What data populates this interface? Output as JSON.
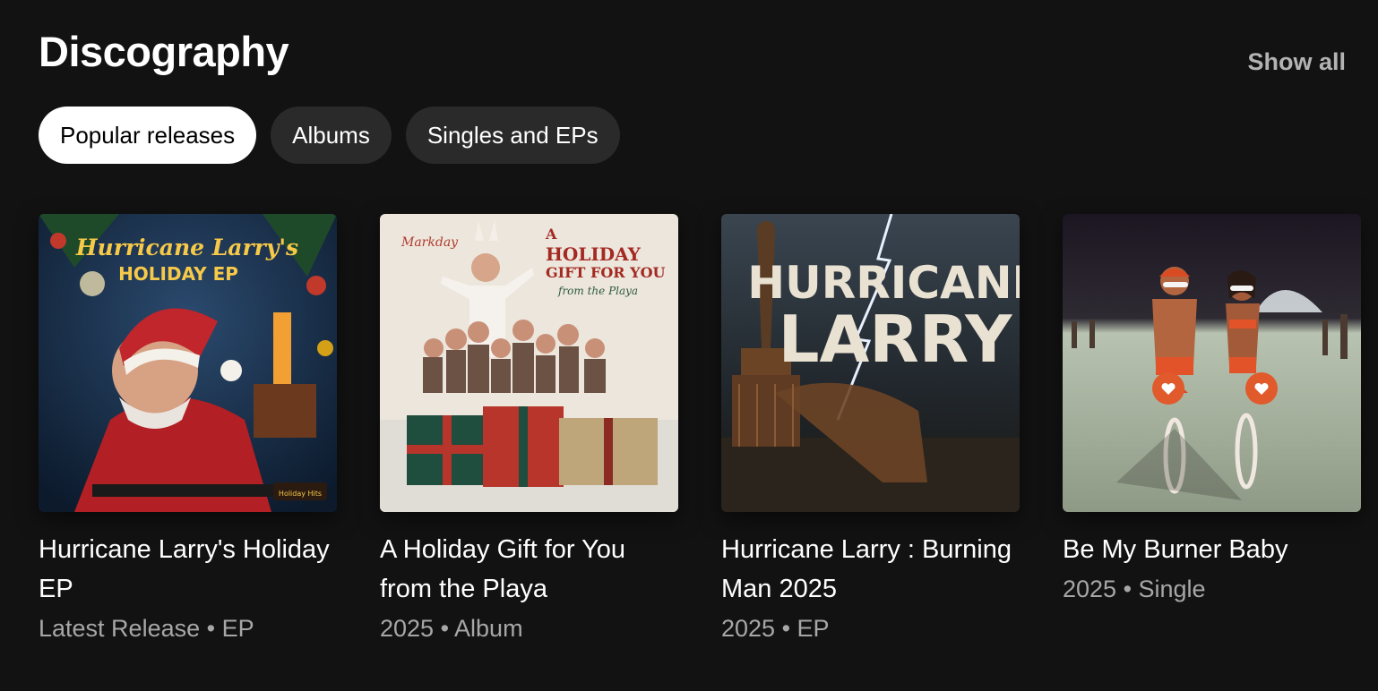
{
  "section": {
    "title": "Discography",
    "show_all": "Show all"
  },
  "filters": [
    {
      "label": "Popular releases",
      "active": true
    },
    {
      "label": "Albums",
      "active": false
    },
    {
      "label": "Singles and EPs",
      "active": false
    }
  ],
  "releases": [
    {
      "title": "Hurricane Larry's Holiday EP",
      "subtitle": "Latest Release • EP",
      "cover": {
        "name": "holiday-ep-cover",
        "text_line1": "Hurricane Larry's",
        "text_line2": "HOLIDAY EP",
        "badge": "Holiday Hits"
      }
    },
    {
      "title": "A Holiday Gift for You from the Playa",
      "subtitle": "2025 • Album",
      "cover": {
        "name": "holiday-gift-cover",
        "brand": "Markday",
        "text_line1": "A",
        "text_line2": "HOLIDAY",
        "text_line3": "GIFT FOR YOU",
        "text_line4": "from the Playa"
      }
    },
    {
      "title": "Hurricane Larry : Burning Man 2025",
      "subtitle": "2025 • EP",
      "cover": {
        "name": "burning-man-cover",
        "text_line1": "HURRICANE",
        "text_line2": "LARRY"
      }
    },
    {
      "title": "Be My Burner Baby",
      "subtitle": "2025 • Single",
      "cover": {
        "name": "burner-baby-cover"
      }
    }
  ],
  "colors": {
    "background": "#121212",
    "chip": "#2a2a2a",
    "chip_active": "#ffffff",
    "muted_text": "#a7a7a7"
  }
}
